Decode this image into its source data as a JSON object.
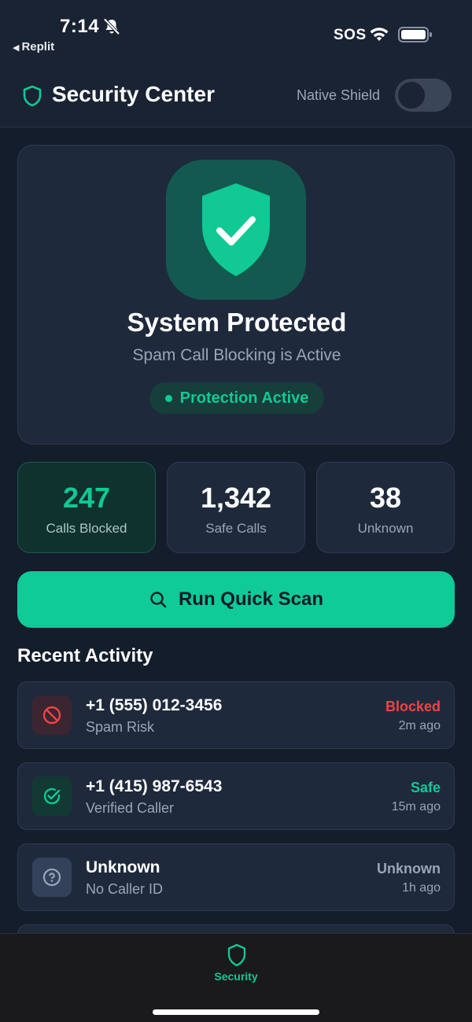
{
  "status_bar": {
    "time": "7:14",
    "back_app": "Replit",
    "sos": "SOS"
  },
  "header": {
    "title": "Security Center",
    "native_shield_label": "Native Shield",
    "native_shield_on": false
  },
  "hero": {
    "title": "System Protected",
    "subtitle": "Spam Call Blocking is Active",
    "badge": "Protection Active"
  },
  "stats": [
    {
      "value": "247",
      "label": "Calls Blocked"
    },
    {
      "value": "1,342",
      "label": "Safe Calls"
    },
    {
      "value": "38",
      "label": "Unknown"
    }
  ],
  "scan_button": {
    "label": "Run Quick Scan"
  },
  "recent_activity": {
    "title": "Recent Activity",
    "items": [
      {
        "number": "+1 (555) 012-3456",
        "desc": "Spam Risk",
        "status": "Blocked",
        "time": "2m ago",
        "icon": "blocked-icon"
      },
      {
        "number": "+1 (415) 987-6543",
        "desc": "Verified Caller",
        "status": "Safe",
        "time": "15m ago",
        "icon": "check-circle-icon"
      },
      {
        "number": "Unknown",
        "desc": "No Caller ID",
        "status": "Unknown",
        "time": "1h ago",
        "icon": "question-icon"
      }
    ]
  },
  "bottom_nav": {
    "items": [
      {
        "label": "Security",
        "icon": "shield-icon"
      }
    ]
  },
  "colors": {
    "accent": "#10c995",
    "blocked": "#ef4444",
    "background": "#141d2b",
    "card": "#1e2a3c"
  }
}
